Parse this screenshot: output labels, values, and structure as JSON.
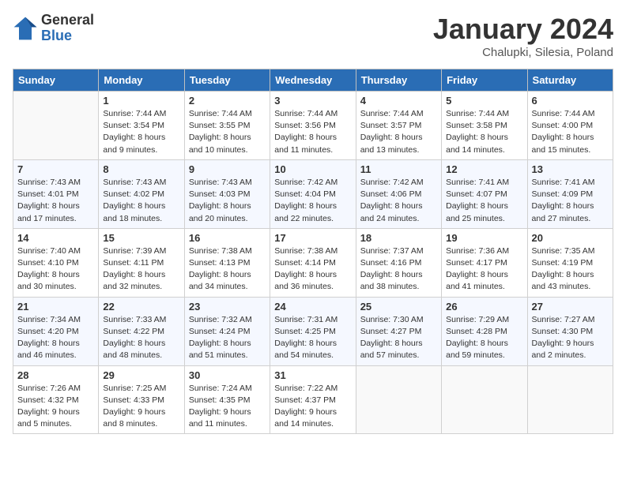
{
  "logo": {
    "general": "General",
    "blue": "Blue"
  },
  "title": "January 2024",
  "location": "Chalupki, Silesia, Poland",
  "weekdays": [
    "Sunday",
    "Monday",
    "Tuesday",
    "Wednesday",
    "Thursday",
    "Friday",
    "Saturday"
  ],
  "weeks": [
    [
      {
        "day": "",
        "info": ""
      },
      {
        "day": "1",
        "info": "Sunrise: 7:44 AM\nSunset: 3:54 PM\nDaylight: 8 hours\nand 9 minutes."
      },
      {
        "day": "2",
        "info": "Sunrise: 7:44 AM\nSunset: 3:55 PM\nDaylight: 8 hours\nand 10 minutes."
      },
      {
        "day": "3",
        "info": "Sunrise: 7:44 AM\nSunset: 3:56 PM\nDaylight: 8 hours\nand 11 minutes."
      },
      {
        "day": "4",
        "info": "Sunrise: 7:44 AM\nSunset: 3:57 PM\nDaylight: 8 hours\nand 13 minutes."
      },
      {
        "day": "5",
        "info": "Sunrise: 7:44 AM\nSunset: 3:58 PM\nDaylight: 8 hours\nand 14 minutes."
      },
      {
        "day": "6",
        "info": "Sunrise: 7:44 AM\nSunset: 4:00 PM\nDaylight: 8 hours\nand 15 minutes."
      }
    ],
    [
      {
        "day": "7",
        "info": "Sunrise: 7:43 AM\nSunset: 4:01 PM\nDaylight: 8 hours\nand 17 minutes."
      },
      {
        "day": "8",
        "info": "Sunrise: 7:43 AM\nSunset: 4:02 PM\nDaylight: 8 hours\nand 18 minutes."
      },
      {
        "day": "9",
        "info": "Sunrise: 7:43 AM\nSunset: 4:03 PM\nDaylight: 8 hours\nand 20 minutes."
      },
      {
        "day": "10",
        "info": "Sunrise: 7:42 AM\nSunset: 4:04 PM\nDaylight: 8 hours\nand 22 minutes."
      },
      {
        "day": "11",
        "info": "Sunrise: 7:42 AM\nSunset: 4:06 PM\nDaylight: 8 hours\nand 24 minutes."
      },
      {
        "day": "12",
        "info": "Sunrise: 7:41 AM\nSunset: 4:07 PM\nDaylight: 8 hours\nand 25 minutes."
      },
      {
        "day": "13",
        "info": "Sunrise: 7:41 AM\nSunset: 4:09 PM\nDaylight: 8 hours\nand 27 minutes."
      }
    ],
    [
      {
        "day": "14",
        "info": "Sunrise: 7:40 AM\nSunset: 4:10 PM\nDaylight: 8 hours\nand 30 minutes."
      },
      {
        "day": "15",
        "info": "Sunrise: 7:39 AM\nSunset: 4:11 PM\nDaylight: 8 hours\nand 32 minutes."
      },
      {
        "day": "16",
        "info": "Sunrise: 7:38 AM\nSunset: 4:13 PM\nDaylight: 8 hours\nand 34 minutes."
      },
      {
        "day": "17",
        "info": "Sunrise: 7:38 AM\nSunset: 4:14 PM\nDaylight: 8 hours\nand 36 minutes."
      },
      {
        "day": "18",
        "info": "Sunrise: 7:37 AM\nSunset: 4:16 PM\nDaylight: 8 hours\nand 38 minutes."
      },
      {
        "day": "19",
        "info": "Sunrise: 7:36 AM\nSunset: 4:17 PM\nDaylight: 8 hours\nand 41 minutes."
      },
      {
        "day": "20",
        "info": "Sunrise: 7:35 AM\nSunset: 4:19 PM\nDaylight: 8 hours\nand 43 minutes."
      }
    ],
    [
      {
        "day": "21",
        "info": "Sunrise: 7:34 AM\nSunset: 4:20 PM\nDaylight: 8 hours\nand 46 minutes."
      },
      {
        "day": "22",
        "info": "Sunrise: 7:33 AM\nSunset: 4:22 PM\nDaylight: 8 hours\nand 48 minutes."
      },
      {
        "day": "23",
        "info": "Sunrise: 7:32 AM\nSunset: 4:24 PM\nDaylight: 8 hours\nand 51 minutes."
      },
      {
        "day": "24",
        "info": "Sunrise: 7:31 AM\nSunset: 4:25 PM\nDaylight: 8 hours\nand 54 minutes."
      },
      {
        "day": "25",
        "info": "Sunrise: 7:30 AM\nSunset: 4:27 PM\nDaylight: 8 hours\nand 57 minutes."
      },
      {
        "day": "26",
        "info": "Sunrise: 7:29 AM\nSunset: 4:28 PM\nDaylight: 8 hours\nand 59 minutes."
      },
      {
        "day": "27",
        "info": "Sunrise: 7:27 AM\nSunset: 4:30 PM\nDaylight: 9 hours\nand 2 minutes."
      }
    ],
    [
      {
        "day": "28",
        "info": "Sunrise: 7:26 AM\nSunset: 4:32 PM\nDaylight: 9 hours\nand 5 minutes."
      },
      {
        "day": "29",
        "info": "Sunrise: 7:25 AM\nSunset: 4:33 PM\nDaylight: 9 hours\nand 8 minutes."
      },
      {
        "day": "30",
        "info": "Sunrise: 7:24 AM\nSunset: 4:35 PM\nDaylight: 9 hours\nand 11 minutes."
      },
      {
        "day": "31",
        "info": "Sunrise: 7:22 AM\nSunset: 4:37 PM\nDaylight: 9 hours\nand 14 minutes."
      },
      {
        "day": "",
        "info": ""
      },
      {
        "day": "",
        "info": ""
      },
      {
        "day": "",
        "info": ""
      }
    ]
  ]
}
